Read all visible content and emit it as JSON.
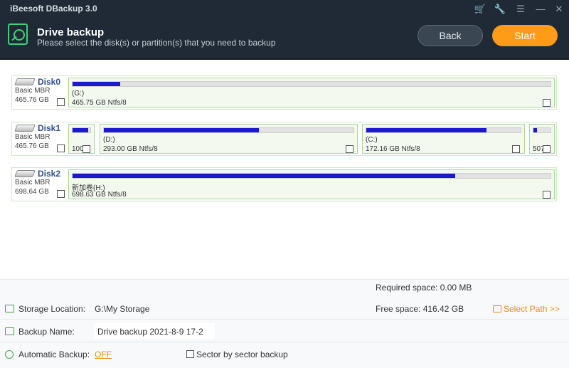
{
  "app": {
    "title": "iBeesoft DBackup 3.0"
  },
  "header": {
    "title": "Drive backup",
    "subtitle": "Please select the disk(s) or partition(s) that you need to backup",
    "back_label": "Back",
    "start_label": "Start"
  },
  "disks": [
    {
      "name": "Disk0",
      "type": "Basic MBR",
      "size": "465.76 GB",
      "partitions": [
        {
          "label": "(G:)",
          "desc": "465.75 GB Ntfs/8",
          "used": 0.1
        }
      ]
    },
    {
      "name": "Disk1",
      "type": "Basic MBR",
      "size": "465.76 GB",
      "partitions": [
        {
          "label": "",
          "desc": "100",
          "used": 0.88
        },
        {
          "label": "(D:)",
          "desc": "293.00 GB Ntfs/8",
          "used": 0.62
        },
        {
          "label": "(C:)",
          "desc": "172.16 GB Ntfs/8",
          "used": 0.78
        },
        {
          "label": "",
          "desc": "507",
          "used": 0.2
        }
      ]
    },
    {
      "name": "Disk2",
      "type": "Basic MBR",
      "size": "698.64 GB",
      "partitions": [
        {
          "label": "新加卷(H:)",
          "desc": "698.63 GB Ntfs/8",
          "used": 0.8
        }
      ]
    }
  ],
  "footer": {
    "required_space": "Required space: 0.00 MB",
    "storage_location_label": "Storage Location:",
    "storage_location_value": "G:\\My Storage",
    "free_space": "Free space: 416.42 GB",
    "select_path": "Select Path >>",
    "backup_name_label": "Backup Name:",
    "backup_name_value": "Drive backup 2021-8-9 17-2",
    "automatic_backup_label": "Automatic Backup:",
    "automatic_backup_value": "OFF",
    "sector_label": "Sector by sector backup"
  },
  "colors": {
    "accent": "#ff9b17",
    "header_bg": "#1f2a36",
    "usage_fill": "#1a1acb"
  }
}
